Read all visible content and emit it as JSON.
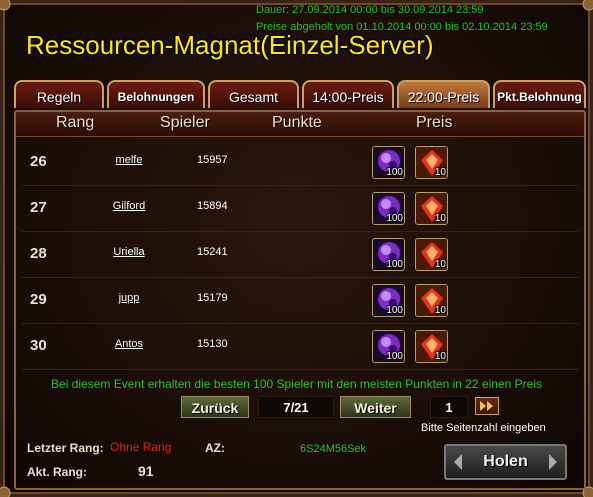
{
  "window": {
    "duration_text": "Dauer: 27.09.2014 00:00 bis 30.09.2014 23:59",
    "prizes_text": "Preise abgeholt von 01.10.2014 00:00 bis 02.10.2014 23:59",
    "title": "Ressourcen-Magnat(Einzel-Server)"
  },
  "tabs": [
    {
      "label": "Regeln"
    },
    {
      "label": "Belohnungen"
    },
    {
      "label": "Gesamt"
    },
    {
      "label": "14:00-Preis"
    },
    {
      "label": "22:00-Preis",
      "active": true
    },
    {
      "label": "Pkt.Belohnung"
    }
  ],
  "table": {
    "headers": {
      "rank": "Rang",
      "player": "Spieler",
      "points": "Punkte",
      "prize": "Preis"
    },
    "rows": [
      {
        "rank": "26",
        "player": "melfe",
        "points": "15957",
        "prizes": [
          {
            "icon": "purple-orb-icon",
            "qty": "100"
          },
          {
            "icon": "red-gem-icon",
            "qty": "10"
          }
        ]
      },
      {
        "rank": "27",
        "player": "Gilford",
        "points": "15894",
        "prizes": [
          {
            "icon": "purple-orb-icon",
            "qty": "100"
          },
          {
            "icon": "red-gem-icon",
            "qty": "10"
          }
        ]
      },
      {
        "rank": "28",
        "player": "Uriella",
        "points": "15241",
        "prizes": [
          {
            "icon": "purple-orb-icon",
            "qty": "100"
          },
          {
            "icon": "red-gem-icon",
            "qty": "10"
          }
        ]
      },
      {
        "rank": "29",
        "player": "jupp",
        "points": "15179",
        "prizes": [
          {
            "icon": "purple-orb-icon",
            "qty": "100"
          },
          {
            "icon": "red-gem-icon",
            "qty": "10"
          }
        ]
      },
      {
        "rank": "30",
        "player": "Antos",
        "points": "15130",
        "prizes": [
          {
            "icon": "purple-orb-icon",
            "qty": "100"
          },
          {
            "icon": "red-gem-icon",
            "qty": "10"
          }
        ]
      }
    ]
  },
  "event_note": "Bei diesem Event erhalten die besten 100 Spieler mit den meisten Punkten in 22 einen Preis",
  "pagination": {
    "prev_label": "Zurück",
    "page_display": "7/21",
    "next_label": "Weiter",
    "page_input_value": "1",
    "hint": "Bitte Seitenzahl eingeben"
  },
  "footer": {
    "last_rank_label": "Letzter Rang:",
    "last_rank_value": "Ohne Rang",
    "az_label": "AZ:",
    "az_value": "6S24M56Sek",
    "current_rank_label": "Akt. Rang:",
    "current_rank_value": "91",
    "claim_button": "Holen"
  },
  "colors": {
    "title": "#ffea00",
    "info_green": "#24c51c",
    "alert_red": "#d8241c"
  }
}
